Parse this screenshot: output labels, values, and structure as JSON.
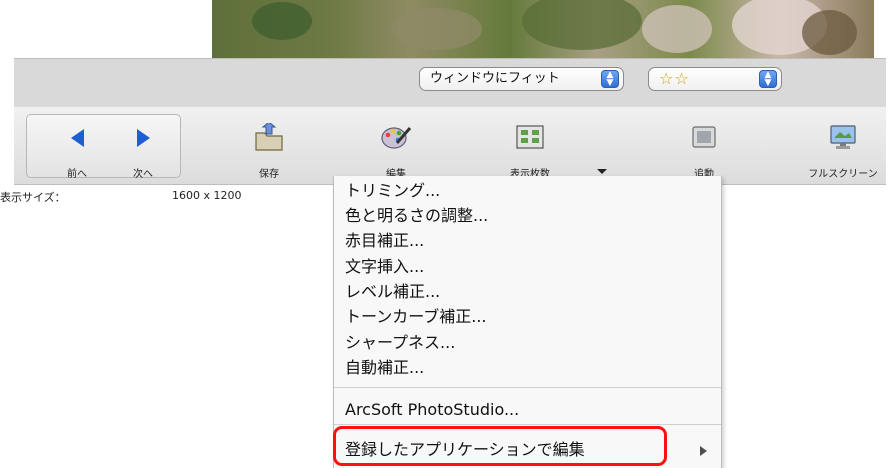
{
  "viewbar": {
    "fit_select_value": "ウィンドウにフィット",
    "rating_stars": "☆☆"
  },
  "toolbar": {
    "prev_label": "前へ",
    "next_label": "次へ",
    "save_label": "保存",
    "edit_label": "編集",
    "display_count_label": "表示枚数",
    "slideshow_label": "追動",
    "fullscreen_label": "フルスクリーン"
  },
  "status": {
    "display_size_label": "表示サイズ：",
    "display_size_value": "1600 x 1200"
  },
  "menu": {
    "items": [
      "トリミング...",
      "色と明るさの調整...",
      "赤目補正...",
      "文字挿入...",
      "レベル補正...",
      "トーンカーブ補正...",
      "シャープネス...",
      "自動補正...",
      "ArcSoft PhotoStudio...",
      "登録したアプリケーションで編集"
    ]
  },
  "colors": {
    "accent_blue": "#1e5fd0",
    "highlight_red": "#ff1010"
  }
}
